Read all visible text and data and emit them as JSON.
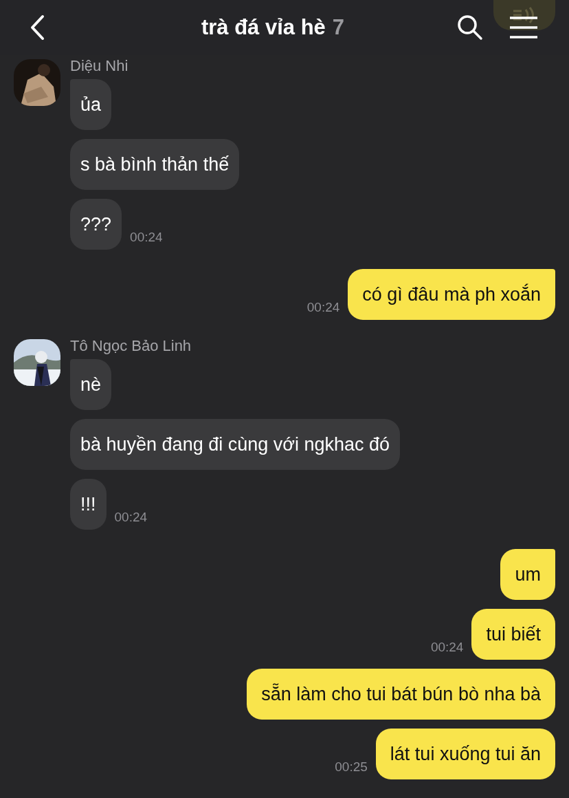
{
  "header": {
    "title": "trà đá vỉa hè",
    "member_count": "7"
  },
  "messages": [
    {
      "kind": "incoming",
      "sender": "Diệu Nhi",
      "avatar": {
        "kind": "picture"
      },
      "bubbles": [
        {
          "text": "ủa"
        },
        {
          "text": "s bà bình thản thế"
        },
        {
          "text": "???",
          "time": "00:24"
        }
      ]
    },
    {
      "kind": "outgoing",
      "bubbles": [
        {
          "text": "có gì đâu mà ph xoắn",
          "time": "00:24"
        }
      ]
    },
    {
      "kind": "incoming",
      "sender": "Tô Ngọc Bảo Linh",
      "avatar": {
        "kind": "picture"
      },
      "bubbles": [
        {
          "text": "nè"
        },
        {
          "text": "bà huyền đang đi cùng với ngkhac đó"
        },
        {
          "text": "!!!",
          "time": "00:24"
        }
      ]
    },
    {
      "kind": "outgoing",
      "bubbles": [
        {
          "text": "um"
        },
        {
          "text": "tui biết",
          "time": "00:24"
        },
        {
          "text": "sẵn làm cho tui bát bún bò nha bà"
        },
        {
          "text": "lát tui xuống tui ăn",
          "time": "00:25"
        }
      ]
    }
  ]
}
